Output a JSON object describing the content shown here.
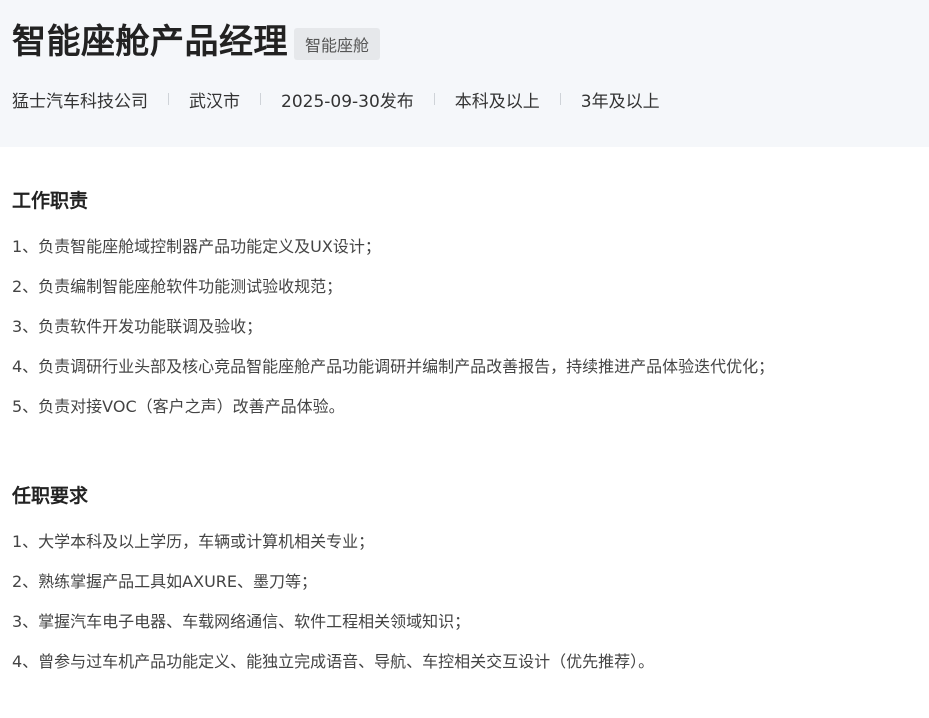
{
  "job": {
    "title": "智能座舱产品经理",
    "tag": "智能座舱",
    "company": "猛士汽车科技公司",
    "location": "武汉市",
    "published": "2025-09-30发布",
    "education": "本科及以上",
    "experience": "3年及以上"
  },
  "duties": {
    "title": "工作职责",
    "items": [
      "1、负责智能座舱域控制器产品功能定义及UX设计；",
      "2、负责编制智能座舱软件功能测试验收规范；",
      "3、负责软件开发功能联调及验收；",
      "4、负责调研行业头部及核心竞品智能座舱产品功能调研并编制产品改善报告，持续推进产品体验迭代优化；",
      "5、负责对接VOC（客户之声）改善产品体验。"
    ]
  },
  "requirements": {
    "title": "任职要求",
    "items": [
      "1、大学本科及以上学历，车辆或计算机相关专业；",
      "2、熟练掌握产品工具如AXURE、墨刀等；",
      "3、掌握汽车电子电器、车载网络通信、软件工程相关领域知识；",
      "4、曾参与过车机产品功能定义、能独立完成语音、导航、车控相关交互设计（优先推荐）。"
    ]
  }
}
